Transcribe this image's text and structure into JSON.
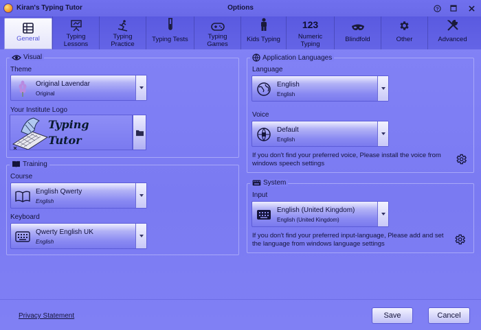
{
  "window": {
    "app_title": "Kiran's Typing Tutor",
    "title": "Options"
  },
  "tabs": [
    {
      "label": "General",
      "icon": "table-icon",
      "active": true
    },
    {
      "label": "Typing Lessons",
      "icon": "presentation-board-icon"
    },
    {
      "label": "Typing Practice",
      "icon": "skier-icon"
    },
    {
      "label": "Typing Tests",
      "icon": "test-tube-icon"
    },
    {
      "label": "Typing Games",
      "icon": "gamepad-icon"
    },
    {
      "label": "Kids Typing",
      "icon": "child-icon"
    },
    {
      "label": "Numeric Typing",
      "icon": "numbers-icon",
      "icon_text": "123"
    },
    {
      "label": "Blindfold",
      "icon": "blindfold-mask-icon"
    },
    {
      "label": "Other",
      "icon": "gear-icon"
    },
    {
      "label": "Advanced",
      "icon": "tools-icon"
    }
  ],
  "visual": {
    "title": "Visual",
    "theme_label": "Theme",
    "theme_value": "Original Lavendar",
    "theme_sub": "Original",
    "logo_label": "Your Institute Logo",
    "logo_line1": "Typing",
    "logo_line2": "Tutor"
  },
  "training": {
    "title": "Training",
    "course_label": "Course",
    "course_value": "English Qwerty",
    "course_sub": "English",
    "keyboard_label": "Keyboard",
    "keyboard_value": "Qwerty English UK",
    "keyboard_sub": "English"
  },
  "app_languages": {
    "title": "Application Languages",
    "language_label": "Language",
    "language_value": "English",
    "language_sub": "English",
    "voice_label": "Voice",
    "voice_value": "Default",
    "voice_sub": "English",
    "voice_note": "If you don't find your preferred voice, Please install the voice from windows speech settings"
  },
  "system": {
    "title": "System",
    "input_label": "Input",
    "input_value": "English (United Kingdom)",
    "input_sub": "English (United Kingdom)",
    "input_note": "If you don't find your preferred input-language, Please add and set the language from windows language settings"
  },
  "footer": {
    "privacy_link": "Privacy Statement",
    "save_label": "Save",
    "cancel_label": "Cancel"
  },
  "colors": {
    "background": "#7a7af2",
    "tabbar": "#5e5ee2",
    "active_tab_text": "#5050d8"
  }
}
